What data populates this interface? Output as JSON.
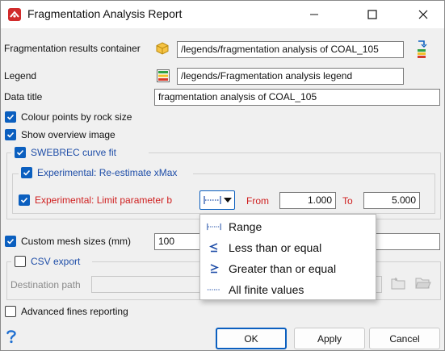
{
  "window": {
    "title": "Fragmentation Analysis Report"
  },
  "fields": {
    "results_container": {
      "label": "Fragmentation results container",
      "value": "/legends/fragmentation analysis of COAL_105"
    },
    "legend": {
      "label": "Legend",
      "value": "/legends/Fragmentation analysis legend"
    },
    "data_title": {
      "label": "Data title",
      "value": "fragmentation analysis of COAL_105"
    }
  },
  "checkboxes": {
    "colour_points": {
      "label": "Colour points by rock size",
      "checked": true
    },
    "show_overview": {
      "label": "Show overview image",
      "checked": true
    },
    "swebrec": {
      "label": "SWEBREC curve fit",
      "checked": true
    },
    "reestimate": {
      "label": "Experimental: Re-estimate xMax",
      "checked": true
    },
    "limit_b": {
      "label": "Experimental: Limit parameter b",
      "checked": true
    },
    "custom_mesh": {
      "label": "Custom mesh sizes (mm)",
      "checked": true,
      "value": "100"
    },
    "csv_export": {
      "label": "CSV export",
      "checked": false
    },
    "advanced_fines": {
      "label": "Advanced fines reporting",
      "checked": false
    }
  },
  "limit": {
    "from_label": "From",
    "from_value": "1.000",
    "to_label": "To",
    "to_value": "5.000"
  },
  "destination": {
    "label": "Destination path",
    "value": ""
  },
  "dropdown": {
    "items": [
      {
        "label": "Range",
        "icon": "range-icon"
      },
      {
        "label": "Less than or equal",
        "icon": "less-equal-icon"
      },
      {
        "label": "Greater than or equal",
        "icon": "greater-equal-icon"
      },
      {
        "label": "All finite values",
        "icon": "all-values-icon"
      }
    ]
  },
  "buttons": {
    "ok": "OK",
    "apply": "Apply",
    "cancel": "Cancel"
  },
  "colors": {
    "accent": "#0b5fbf",
    "experimental_red": "#cf1f1f",
    "group_blue": "#1f4ea8"
  }
}
